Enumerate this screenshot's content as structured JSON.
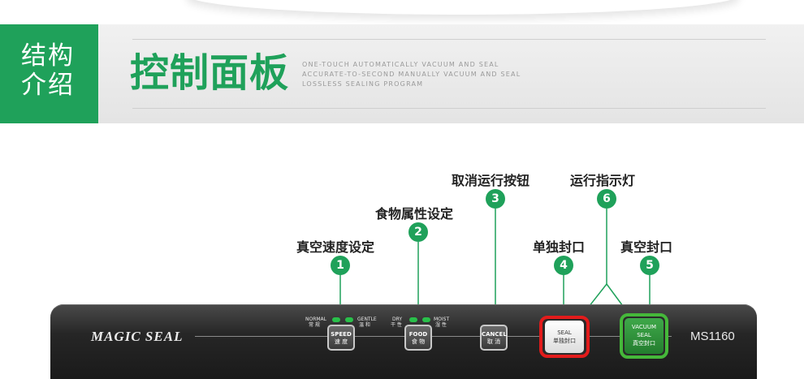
{
  "header": {
    "tag_line1": "结构",
    "tag_line2": "介绍",
    "title": "控制面板",
    "subtitle_lines": [
      "ONE-TOUCH AUTOMATICALLY VACUUM AND SEAL",
      "ACCURATE-TO-SECOND MANUALLY VACUUM AND SEAL",
      "LOSSLESS SEALING PROGRAM"
    ]
  },
  "callouts": [
    {
      "number": "1",
      "label": "真空速度设定"
    },
    {
      "number": "2",
      "label": "食物属性设定"
    },
    {
      "number": "3",
      "label": "取消运行按钮"
    },
    {
      "number": "4",
      "label": "单独封口"
    },
    {
      "number": "5",
      "label": "真空封口"
    },
    {
      "number": "6",
      "label": "运行指示灯"
    }
  ],
  "panel": {
    "brand": "MAGIC SEAL",
    "model": "MS1160",
    "speed": {
      "left_en": "NORMAL",
      "left_cn": "常 规",
      "right_en": "GENTLE",
      "right_cn": "温 和",
      "button_en": "SPEED",
      "button_cn": "速 度"
    },
    "food": {
      "left_en": "DRY",
      "left_cn": "干 性",
      "right_en": "MOIST",
      "right_cn": "湿 性",
      "button_en": "FOOD",
      "button_cn": "食 物"
    },
    "cancel": {
      "button_en": "CANCEL",
      "button_cn": "取 消"
    },
    "seal": {
      "button_en": "SEAL",
      "button_cn": "单独封口"
    },
    "vacuum_seal": {
      "button_en1": "VACUUM",
      "button_en2": "SEAL",
      "button_cn": "真空封口"
    }
  },
  "colors": {
    "accent": "#1fa15a",
    "seal_ring": "#e21b1b",
    "vacuum_ring": "#45b83a",
    "led": "#29c04a"
  }
}
